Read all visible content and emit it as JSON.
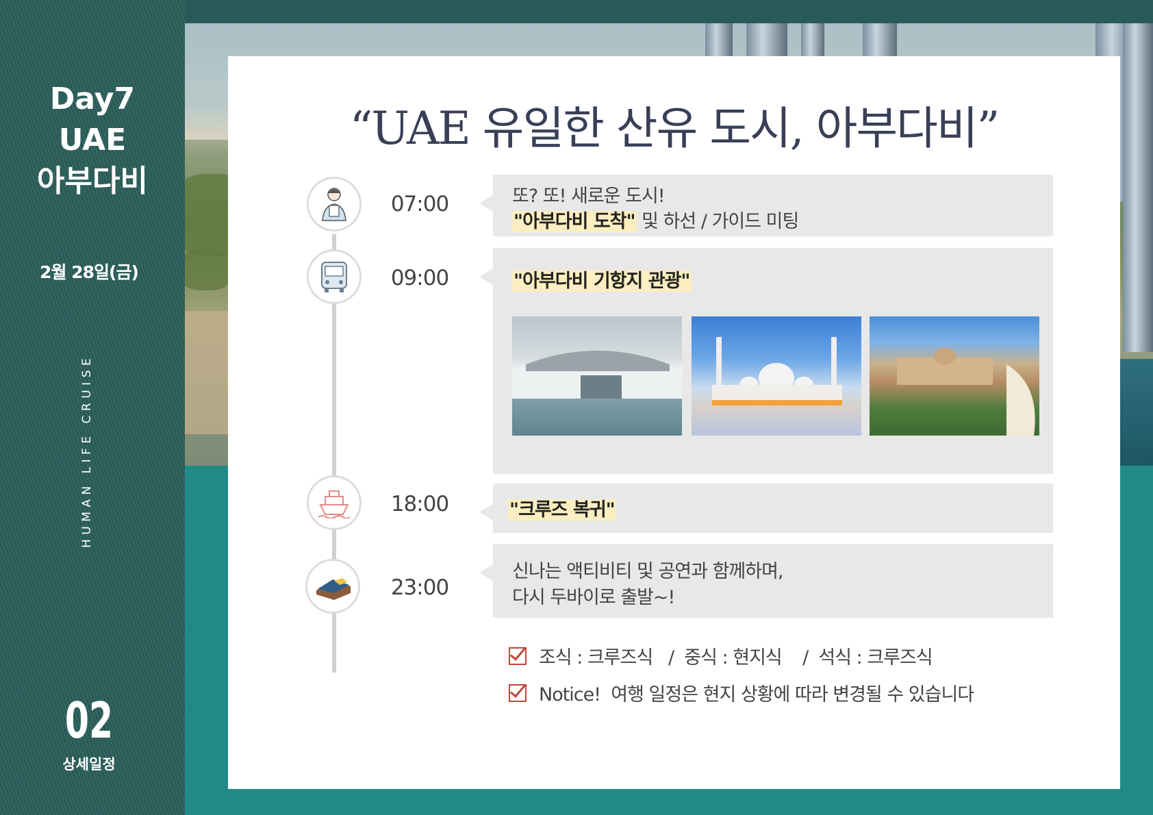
{
  "sidebar": {
    "day": "Day7",
    "country": "UAE",
    "city": "아부다비",
    "date": "2월 28일(금)",
    "vertical_text": "HUMAN LIFE CRUISE",
    "page_number": "02",
    "page_label": "상세일정"
  },
  "headline": "“UAE 유일한 산유 도시, 아부다비”",
  "schedule": [
    {
      "time": "07:00",
      "icon": "guide-person-icon",
      "line1": "또? 또! 새로운 도시!",
      "line2_highlight": "\"아부다비 도착\"",
      "line2_rest": " 및 하선 / 가이드 미팅"
    },
    {
      "time": "09:00",
      "icon": "bus-icon",
      "highlight": "\"아부다비 기항지 관광\"",
      "photos": [
        "louvre-abu-dhabi-photo",
        "sheikh-zayed-mosque-photo",
        "emirates-palace-photo"
      ]
    },
    {
      "time": "18:00",
      "icon": "cruise-ship-icon",
      "highlight": "\"크루즈 복귀\""
    },
    {
      "time": "23:00",
      "icon": "bed-icon",
      "line1": "신나는 액티비티 및 공연과 함께하며,",
      "line2": "다시 두바이로 출발~!"
    }
  ],
  "notes": {
    "meals": "조식 : 크루즈식   /  중식 : 현지식    /  석식 : 크루즈식",
    "notice": "Notice!  여행 일정은 현지 상황에 따라 변경될 수 있습니다"
  },
  "colors": {
    "sidebar": "#2a5956",
    "teal": "#208a87",
    "highlight": "#fbeec0",
    "check": "#c2453a",
    "bubble": "#e8e8e8"
  }
}
